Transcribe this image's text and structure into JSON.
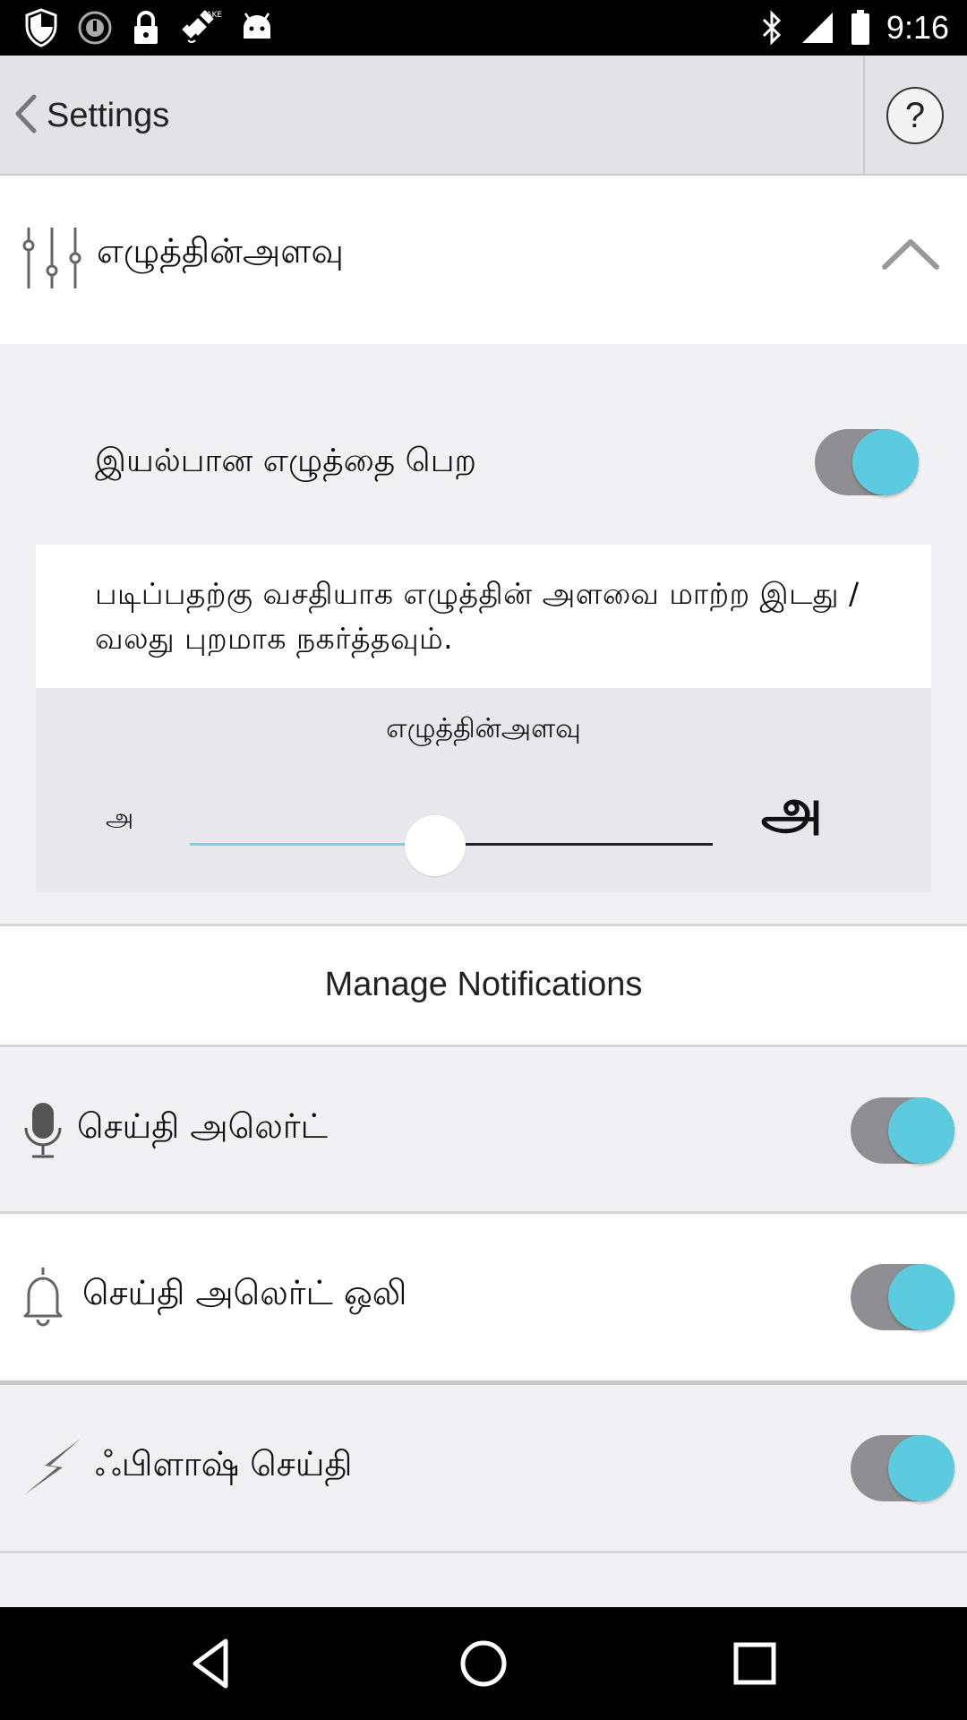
{
  "status_bar": {
    "time": "9:16",
    "left_icons": [
      "shield-icon",
      "alarm-icon",
      "lock-icon",
      "fake-gps-icon",
      "android-icon"
    ],
    "right_icons": [
      "bluetooth-icon",
      "signal-icon",
      "battery-icon"
    ]
  },
  "action_bar": {
    "back_label": "Settings",
    "help_label": "?"
  },
  "font_size_section": {
    "header_label": "எழுத்தின்அளவு",
    "expanded": true,
    "normal_font_label": "இயல்பான எழுத்தை பெற",
    "normal_font_on": true,
    "description": "படிப்பதற்கு வசதியாக எழுத்தின் அளவை மாற்ற இடது / வலது புறமாக நகர்த்தவும்.",
    "slider_title": "எழுத்தின்அளவு",
    "slider_min_glyph": "அ",
    "slider_max_glyph": "அ",
    "slider_value": 0.47
  },
  "manage_notifications": {
    "label": "Manage Notifications"
  },
  "notifications": [
    {
      "label": "செய்தி அலெர்ட்",
      "icon": "microphone-icon",
      "on": true
    },
    {
      "label": "செய்தி அலெர்ட் ஒலி",
      "icon": "bell-icon",
      "on": true
    },
    {
      "label": "ஃபிளாஷ் செய்தி",
      "icon": "flash-icon",
      "on": true
    }
  ],
  "colors": {
    "toggle_knob": "#5ccadf",
    "toggle_track": "#8f8f93",
    "slider_fill": "#7ccfe0",
    "action_bar": "#e3e3e5"
  },
  "nav_bar": {
    "buttons": [
      "back-icon",
      "home-icon",
      "recents-icon"
    ]
  }
}
